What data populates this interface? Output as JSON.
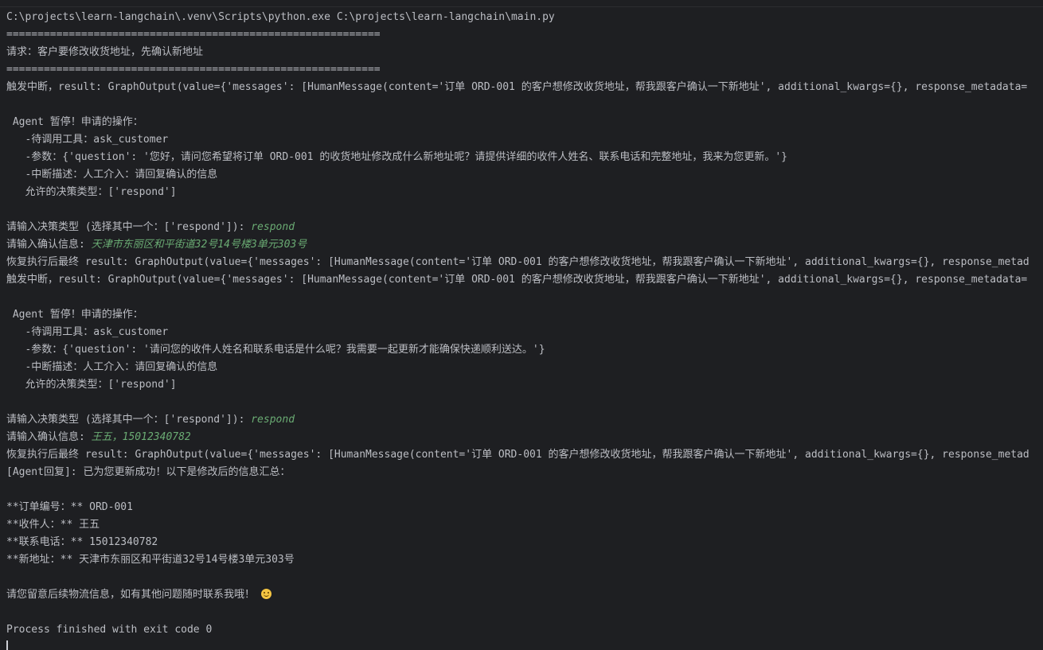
{
  "console": {
    "lines": [
      "C:\\projects\\learn-langchain\\.venv\\Scripts\\python.exe C:\\projects\\learn-langchain\\main.py",
      "============================================================",
      "请求：客户要修改收货地址，先确认新地址",
      "============================================================",
      "触发中断，result: GraphOutput(value={'messages': [HumanMessage(content='订单 ORD-001 的客户想修改收货地址，帮我跟客户确认一下新地址', additional_kwargs={}, response_metadata=",
      "",
      " Agent 暂停！申请的操作：",
      "   -待调用工具：ask_customer",
      "   -参数：{'question': '您好，请问您希望将订单 ORD-001 的收货地址修改成什么新地址呢？请提供详细的收件人姓名、联系电话和完整地址，我来为您更新。'}",
      "   -中断描述：人工介入：请回复确认的信息",
      "   允许的决策类型：['respond']",
      "",
      "请输入决策类型 (选择其中一个：['respond']): ",
      "请输入确认信息: ",
      "恢复执行后最终 result: GraphOutput(value={'messages': [HumanMessage(content='订单 ORD-001 的客户想修改收货地址，帮我跟客户确认一下新地址', additional_kwargs={}, response_metad",
      "触发中断，result: GraphOutput(value={'messages': [HumanMessage(content='订单 ORD-001 的客户想修改收货地址，帮我跟客户确认一下新地址', additional_kwargs={}, response_metadata=",
      "",
      " Agent 暂停！申请的操作：",
      "   -待调用工具：ask_customer",
      "   -参数：{'question': '请问您的收件人姓名和联系电话是什么呢？我需要一起更新才能确保快递顺利送达。'}",
      "   -中断描述：人工介入：请回复确认的信息",
      "   允许的决策类型：['respond']",
      "",
      "请输入决策类型 (选择其中一个：['respond']): ",
      "请输入确认信息: ",
      "恢复执行后最终 result: GraphOutput(value={'messages': [HumanMessage(content='订单 ORD-001 的客户想修改收货地址，帮我跟客户确认一下新地址', additional_kwargs={}, response_metad",
      "[Agent回复]: 已为您更新成功！以下是修改后的信息汇总：",
      "",
      "**订单编号：** ORD-001",
      "**收件人：** 王五",
      "**联系电话：** 15012340782",
      "**新地址：** 天津市东丽区和平街道32号14号楼3单元303号",
      "",
      "请您留意后续物流信息，如有其他问题随时联系我哦！",
      "",
      "Process finished with exit code 0"
    ],
    "inputs": {
      "decision_1": "respond",
      "confirm_1": "天津市东丽区和平街道32号14号楼3单元303号",
      "decision_2": "respond",
      "confirm_2": "王五，15012340782"
    },
    "emoji": "smiling-face-icon"
  },
  "colors": {
    "background": "#1e1f22",
    "text": "#bcbec4",
    "user_input": "#6aab73"
  }
}
